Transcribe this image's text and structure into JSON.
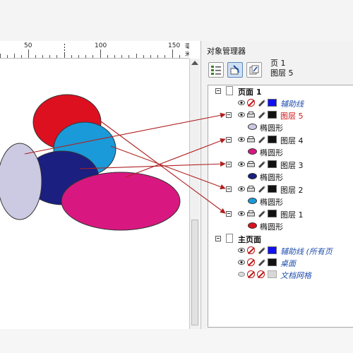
{
  "ruler": {
    "ticks": [
      {
        "label": "50"
      },
      {
        "label": "100"
      },
      {
        "label": "150"
      }
    ],
    "unit": "毫米"
  },
  "canvas": {
    "shapes": [
      {
        "name": "red-ellipse",
        "fill": "#dd1020"
      },
      {
        "name": "blue-ellipse",
        "fill": "#1a9ad8"
      },
      {
        "name": "navy-ellipse",
        "fill": "#1a1f80"
      },
      {
        "name": "lavender-ellipse",
        "fill": "#ccc9e2"
      },
      {
        "name": "magenta-ellipse",
        "fill": "#d81880"
      }
    ],
    "arrow_color": "#b02020"
  },
  "panel": {
    "title": "对象管理器",
    "current_page": "页 1",
    "current_layer": "图层 5",
    "tree": {
      "page1": {
        "label": "页面 1",
        "guides_layer": {
          "label": "辅助线",
          "color": "#1010f0"
        },
        "layers": [
          {
            "label": "图层 5",
            "color": "#111111",
            "object_label": "椭圆形",
            "object_color": "#ccc9e2",
            "active": true
          },
          {
            "label": "图层 4",
            "color": "#111111",
            "object_label": "椭圆形",
            "object_color": "#d81880"
          },
          {
            "label": "图层 3",
            "color": "#111111",
            "object_label": "椭圆形",
            "object_color": "#1a1f80"
          },
          {
            "label": "图层 2",
            "color": "#111111",
            "object_label": "椭圆形",
            "object_color": "#1a9ad8"
          },
          {
            "label": "图层 1",
            "color": "#111111",
            "object_label": "椭圆形",
            "object_color": "#dd1020"
          }
        ]
      },
      "master": {
        "label": "主页面",
        "layers": [
          {
            "label": "辅助线 (所有页",
            "color": "#1010f0"
          },
          {
            "label": "桌面",
            "color": "#111111"
          },
          {
            "label": "文档网格",
            "color": "#d8d8d8"
          }
        ]
      }
    }
  }
}
